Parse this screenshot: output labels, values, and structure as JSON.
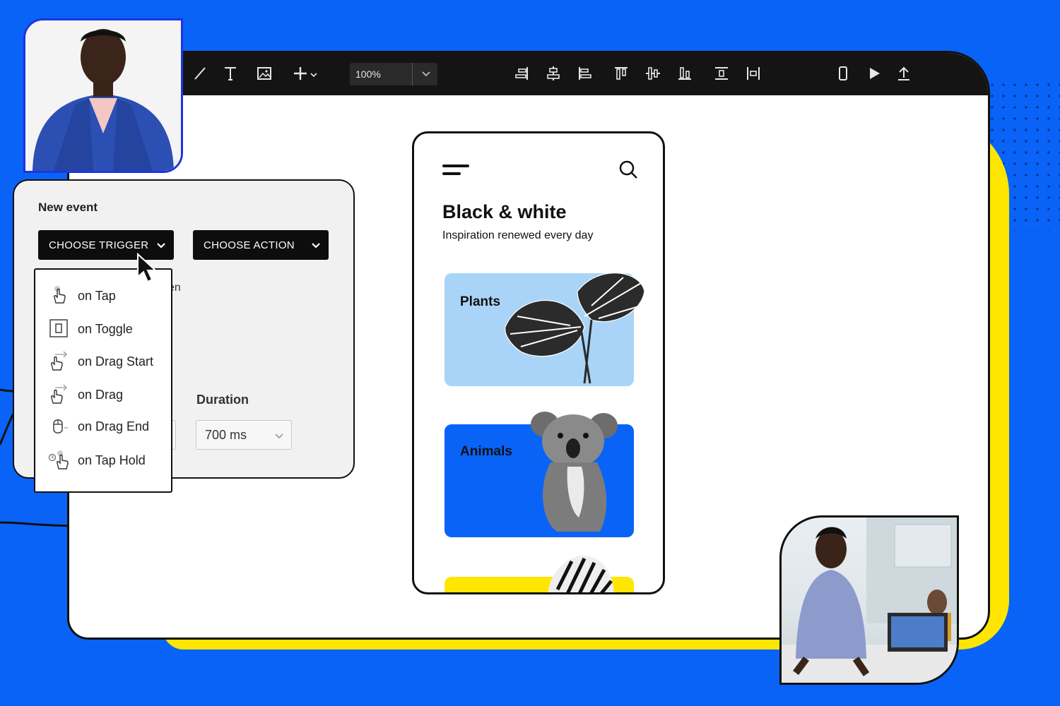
{
  "toolbar": {
    "zoom_value": "100%",
    "icons": [
      "line-icon",
      "text-icon",
      "image-icon",
      "add-icon",
      "align-right-icon",
      "align-center-h-icon",
      "align-left-icon",
      "align-top-icon",
      "align-middle-v-icon",
      "align-bottom-icon",
      "distribute-vertical-icon",
      "distribute-horizontal-icon",
      "device-preview-icon",
      "play-icon",
      "share-export-icon"
    ]
  },
  "event_panel": {
    "title": "New event",
    "trigger_button": "CHOOSE TRIGGER",
    "action_button": "CHOOSE ACTION",
    "partial_text": "en",
    "duration_label": "Duration",
    "duration_value": "700 ms"
  },
  "trigger_menu": {
    "items": [
      {
        "label": "on Tap",
        "icon": "tap-icon"
      },
      {
        "label": "on Toggle",
        "icon": "toggle-icon"
      },
      {
        "label": "on Drag Start",
        "icon": "drag-start-icon"
      },
      {
        "label": "on Drag",
        "icon": "drag-icon"
      },
      {
        "label": "on Drag End",
        "icon": "drag-end-icon"
      },
      {
        "label": "on Tap Hold",
        "icon": "tap-hold-icon"
      }
    ]
  },
  "phone": {
    "title": "Black & white",
    "subtitle": "Inspiration renewed every day",
    "cards": [
      {
        "label": "Plants",
        "color": "#a9d4f7"
      },
      {
        "label": "Animals",
        "color": "#0a63f7"
      },
      {
        "label": "",
        "color": "#ffe600"
      }
    ]
  },
  "colors": {
    "background": "#0a63f7",
    "accent_yellow": "#ffe600",
    "toolbar": "#141414"
  }
}
